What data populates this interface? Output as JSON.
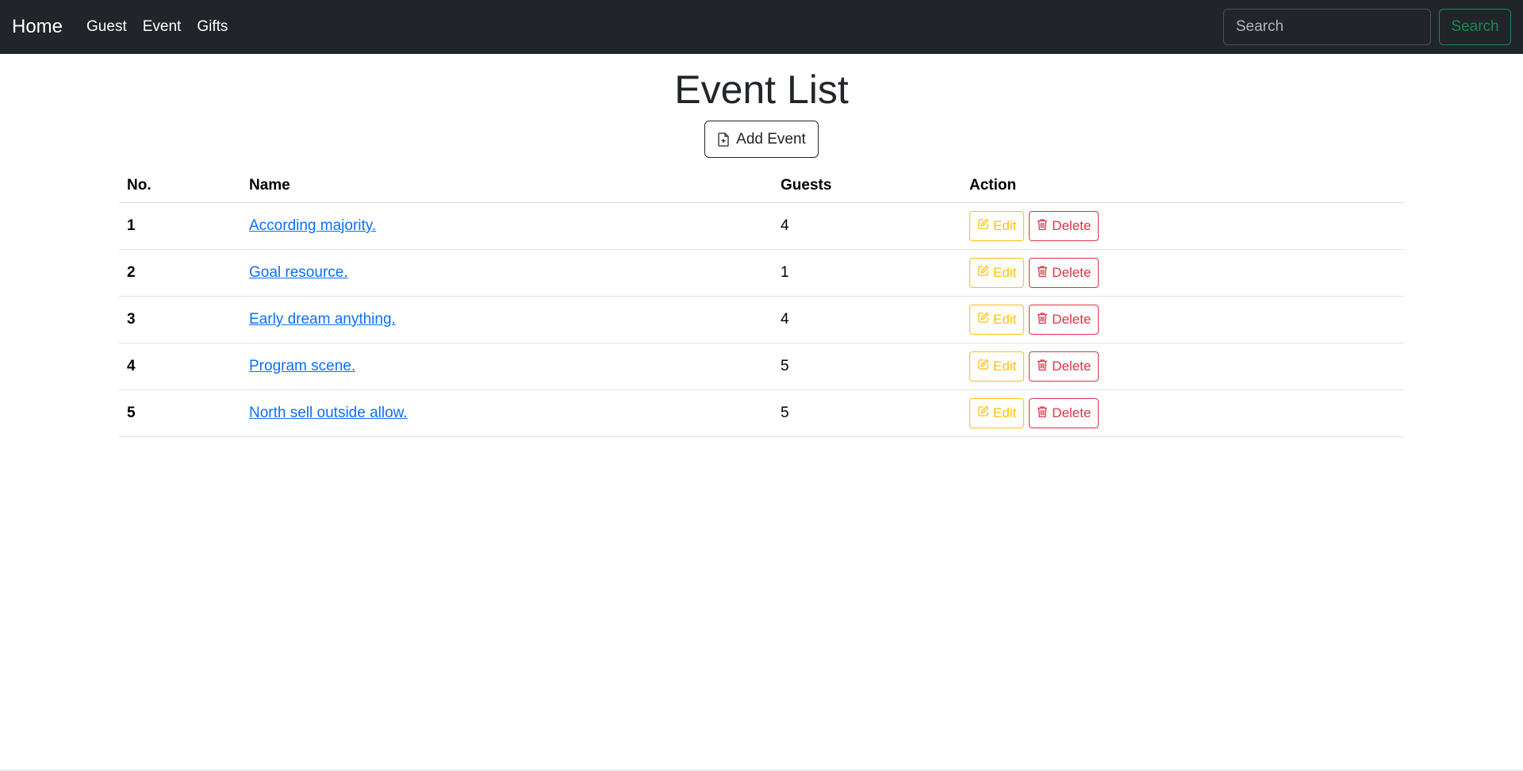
{
  "navbar": {
    "brand": "Home",
    "links": [
      "Guest",
      "Event",
      "Gifts"
    ],
    "search_placeholder": "Search",
    "search_button": "Search"
  },
  "page": {
    "title": "Event List",
    "add_button": "Add Event"
  },
  "table": {
    "headers": [
      "No.",
      "Name",
      "Guests",
      "Action"
    ],
    "rows": [
      {
        "no": "1",
        "name": "According majority.",
        "guests": "4"
      },
      {
        "no": "2",
        "name": "Goal resource.",
        "guests": "1"
      },
      {
        "no": "3",
        "name": "Early dream anything.",
        "guests": "4"
      },
      {
        "no": "4",
        "name": "Program scene.",
        "guests": "5"
      },
      {
        "no": "5",
        "name": "North sell outside allow.",
        "guests": "5"
      }
    ],
    "edit_label": "Edit",
    "delete_label": "Delete"
  },
  "icons": {
    "add": "file-plus-icon",
    "edit": "pencil-square-icon",
    "delete": "trash-icon"
  },
  "colors": {
    "navbar_bg": "#212529",
    "link": "#0d6efd",
    "edit": "#ffc107",
    "delete": "#dc3545",
    "search_button": "#198754"
  }
}
